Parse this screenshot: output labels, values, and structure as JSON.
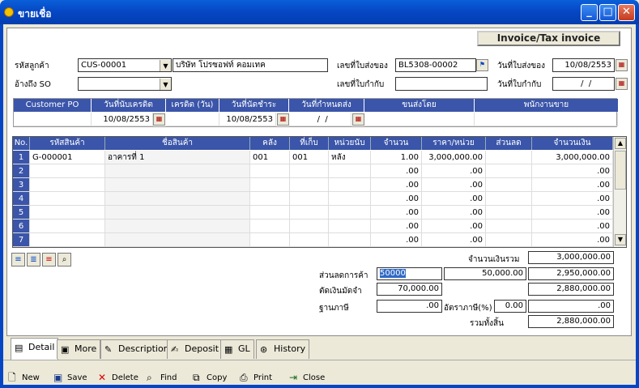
{
  "window": {
    "title": "ขายเชื่อ",
    "min": "_",
    "max": "□",
    "close": "✕"
  },
  "invoice_title": "Invoice/Tax invoice",
  "form": {
    "customer_code_label": "รหัสลูกค้า",
    "customer_code": "CUS-00001",
    "customer_name": "บริษัท โปรซอฟท์ คอมเทค",
    "so_ref_label": "อ้างถึง SO",
    "so_ref": "",
    "delivery_no_label": "เลขที่ใบส่งของ",
    "delivery_no": "BL5308-00002",
    "delivery_date_label": "วันที่ใบส่งของ",
    "delivery_date": "10/08/2553",
    "invoice_no_label": "เลขที่ใบกำกับ",
    "invoice_no": "",
    "invoice_date_label": "วันที่ใบกำกับ",
    "invoice_date": "  /  /"
  },
  "info_table": {
    "headers": [
      "Customer PO",
      "วันที่นับเครดิต",
      "เครดิต (วัน)",
      "วันที่นัดชำระ",
      "วันที่กำหนดส่ง",
      "ขนส่งโดย",
      "พนักงานขาย"
    ],
    "values": [
      "",
      "10/08/2553",
      "",
      "10/08/2553",
      "  /  /",
      "",
      ""
    ]
  },
  "grid": {
    "headers": [
      "No.",
      "รหัสสินค้า",
      "ชื่อสินค้า",
      "คลัง",
      "ที่เก็บ",
      "หน่วยนับ",
      "จำนวน",
      "ราคา/หน่วย",
      "ส่วนลด",
      "จำนวนเงิน"
    ],
    "rows": [
      [
        "1",
        "G-000001",
        "อาคารที่ 1",
        "001",
        "001",
        "หลัง",
        "1.00",
        "3,000,000.00",
        "",
        "3,000,000.00"
      ],
      [
        "2",
        "",
        "",
        "",
        "",
        "",
        ".00",
        ".00",
        "",
        ".00"
      ],
      [
        "3",
        "",
        "",
        "",
        "",
        "",
        ".00",
        ".00",
        "",
        ".00"
      ],
      [
        "4",
        "",
        "",
        "",
        "",
        "",
        ".00",
        ".00",
        "",
        ".00"
      ],
      [
        "5",
        "",
        "",
        "",
        "",
        "",
        ".00",
        ".00",
        "",
        ".00"
      ],
      [
        "6",
        "",
        "",
        "",
        "",
        "",
        ".00",
        ".00",
        "",
        ".00"
      ],
      [
        "7",
        "",
        "",
        "",
        "",
        "",
        ".00",
        ".00",
        "",
        ".00"
      ]
    ]
  },
  "totals": {
    "sum_label": "จำนวนเงินรวม",
    "sum": "3,000,000.00",
    "discount_label": "ส่วนลดการค้า",
    "discount_input": "50000",
    "discount_amount": "50,000.00",
    "after_discount": "2,950,000.00",
    "deposit_label": "ตัดเงินมัดจำ",
    "deposit": "70,000.00",
    "after_deposit": "2,880,000.00",
    "tax_base_label": "ฐานภาษี",
    "tax_base": ".00",
    "tax_rate_label": "อัตราภาษี(%)",
    "tax_rate": "0.00",
    "tax_amount": ".00",
    "grand_total_label": "รวมทั้งสิ้น",
    "grand_total": "2,880,000.00"
  },
  "tabs": [
    "Detail",
    "More",
    "Description",
    "Deposit",
    "GL",
    "History"
  ],
  "toolbar": [
    "New",
    "Save",
    "Delete",
    "Find",
    "Copy",
    "Print",
    "Close"
  ]
}
